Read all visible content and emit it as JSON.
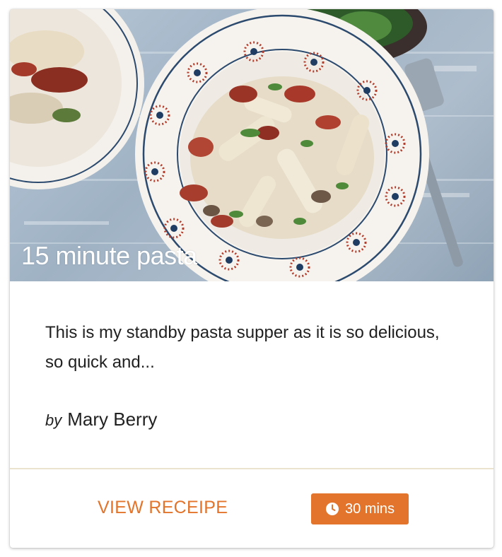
{
  "recipe": {
    "title": "15 minute pasta",
    "description": "This is my standby pasta supper as it is so delicious, so quick and...",
    "by_label": "by",
    "author": "Mary Berry"
  },
  "actions": {
    "view_label": "VIEW RECEIPE",
    "time_label": "30 mins",
    "time_icon": "clock-icon"
  },
  "colors": {
    "accent": "#e2742b",
    "divider": "#ece3cf",
    "text": "#212121"
  }
}
